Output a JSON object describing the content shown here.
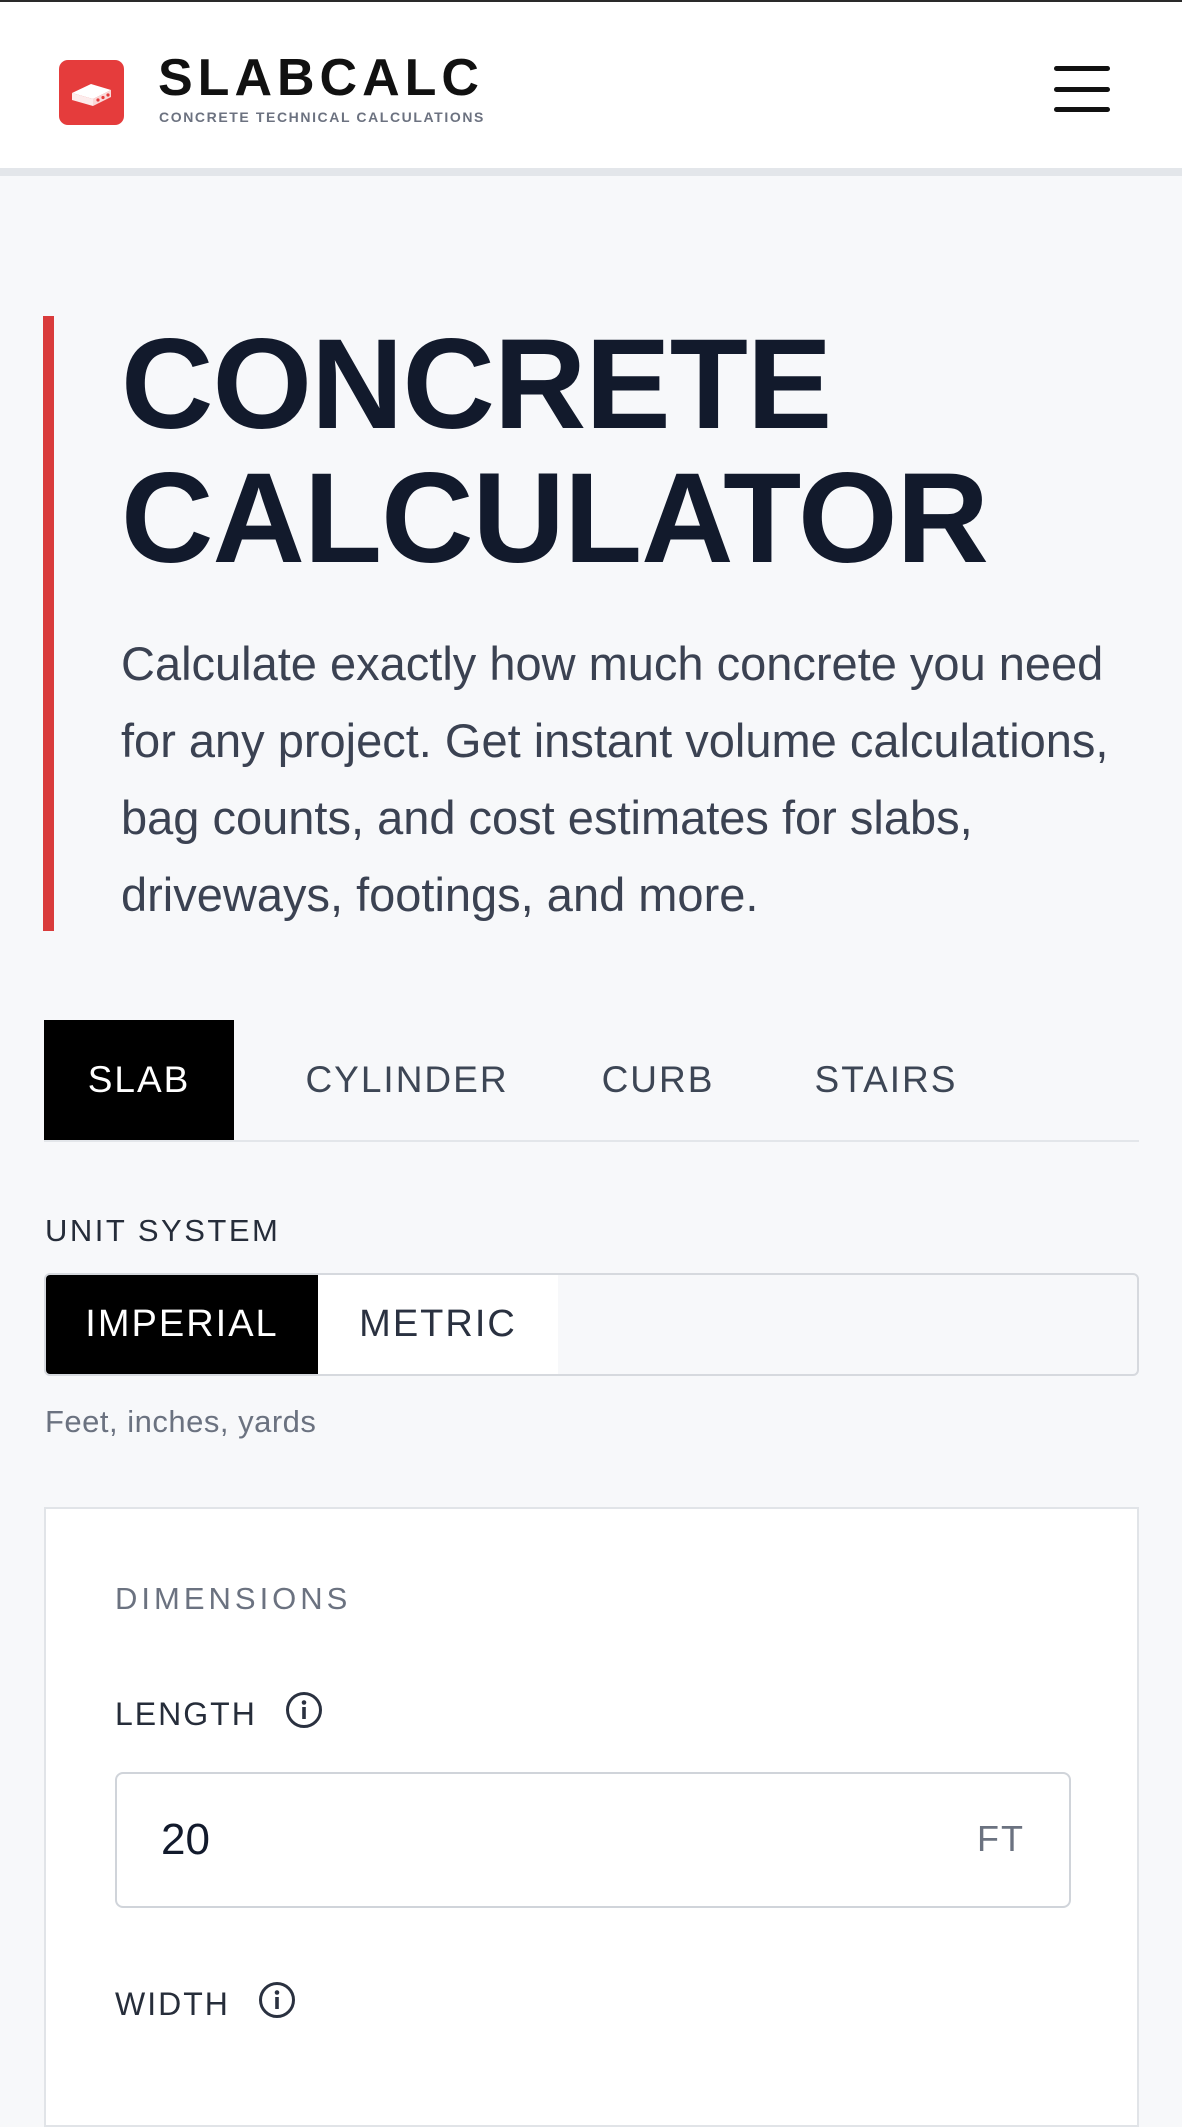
{
  "brand": {
    "name": "SLABCALC",
    "tagline": "CONCRETE TECHNICAL CALCULATIONS"
  },
  "hero": {
    "title_line1": "CONCRETE",
    "title_line2": "CALCULATOR",
    "description": "Calculate exactly how much concrete you need for any project. Get instant volume calculations, bag counts, and cost estimates for slabs, driveways, footings, and more."
  },
  "tabs": [
    {
      "label": "SLAB",
      "active": true
    },
    {
      "label": "CYLINDER",
      "active": false
    },
    {
      "label": "CURB",
      "active": false
    },
    {
      "label": "STAIRS",
      "active": false
    }
  ],
  "unit_system": {
    "label": "UNIT SYSTEM",
    "options": [
      {
        "label": "IMPERIAL",
        "active": true
      },
      {
        "label": "METRIC",
        "active": false
      }
    ],
    "hint": "Feet, inches, yards"
  },
  "dimensions": {
    "title": "DIMENSIONS",
    "length": {
      "label": "LENGTH",
      "value": "20",
      "unit": "FT"
    },
    "width": {
      "label": "WIDTH"
    }
  },
  "colors": {
    "accent_red": "#e53c3c",
    "active_tab": "#000000",
    "heading": "#121a2c"
  },
  "icons": {
    "logo": "concrete-slab-icon",
    "menu": "hamburger-menu-icon",
    "info": "info-circle-icon"
  }
}
